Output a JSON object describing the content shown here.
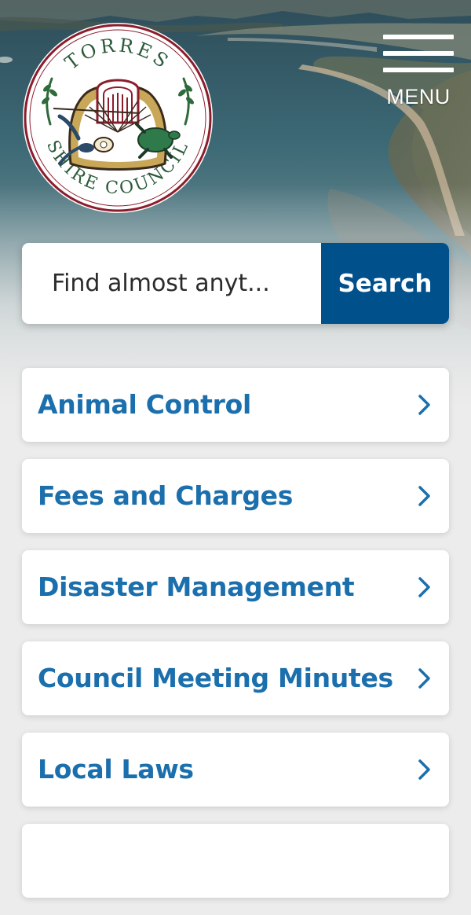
{
  "header": {
    "logo": {
      "alt": "Torres Shire Council",
      "text_top": "TORRES",
      "text_bottom": "SHIRE COUNCIL"
    },
    "menu": {
      "label": "MENU",
      "icon": "hamburger-icon"
    }
  },
  "search": {
    "placeholder": "Find almost anyt...",
    "button_label": "Search"
  },
  "quick_links": [
    {
      "label": "Animal Control",
      "icon": "chevron-right-icon"
    },
    {
      "label": "Fees and Charges",
      "icon": "chevron-right-icon"
    },
    {
      "label": "Disaster Management",
      "icon": "chevron-right-icon"
    },
    {
      "label": "Council Meeting Minutes",
      "icon": "chevron-right-icon"
    },
    {
      "label": "Local Laws",
      "icon": "chevron-right-icon"
    },
    {
      "label": "",
      "icon": "chevron-right-icon"
    }
  ],
  "colors": {
    "accent": "#00508c",
    "link_text": "#1b6fad",
    "page_bg": "#ececec",
    "logo_ring": "#8c1d2c"
  }
}
